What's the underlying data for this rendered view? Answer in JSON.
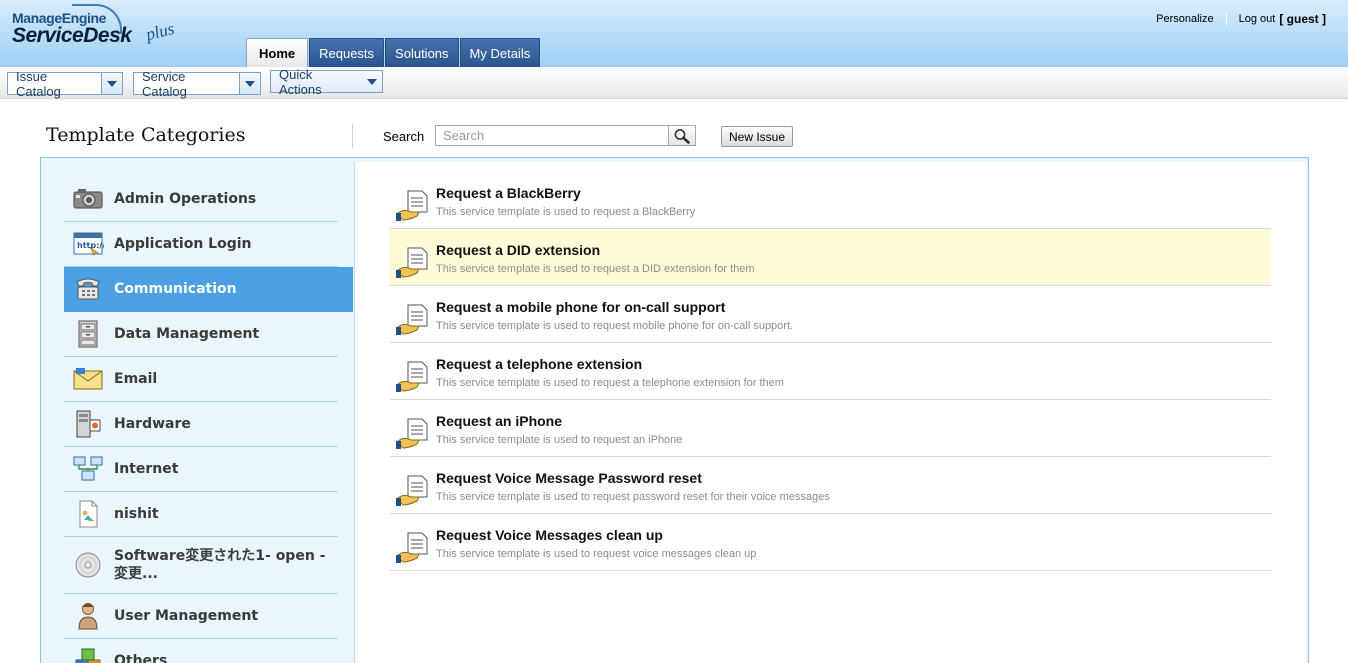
{
  "header": {
    "logo_top": "ManageEngine",
    "logo_main": "ServiceDesk",
    "logo_plus": "plus",
    "personalize": "Personalize",
    "logout": "Log out",
    "user": "[ guest ]",
    "tabs": [
      {
        "label": "Home",
        "active": true
      },
      {
        "label": "Requests",
        "active": false
      },
      {
        "label": "Solutions",
        "active": false
      },
      {
        "label": "My Details",
        "active": false
      }
    ]
  },
  "subbar": {
    "issue_catalog": "Issue Catalog",
    "service_catalog": "Service Catalog",
    "quick_actions": "Quick Actions"
  },
  "page": {
    "title": "Template Categories",
    "search_label": "Search",
    "search_placeholder": "Search",
    "new_issue": "New Issue"
  },
  "categories": [
    {
      "label": "Admin Operations",
      "icon": "camera-icon"
    },
    {
      "label": "Application Login",
      "icon": "browser-login-icon"
    },
    {
      "label": "Communication",
      "icon": "telephone-icon",
      "active": true
    },
    {
      "label": "Data Management",
      "icon": "filing-cabinet-icon"
    },
    {
      "label": "Email",
      "icon": "envelope-icon"
    },
    {
      "label": "Hardware",
      "icon": "computer-tower-icon"
    },
    {
      "label": "Internet",
      "icon": "network-icon"
    },
    {
      "label": "nishit",
      "icon": "document-icon"
    },
    {
      "label": "Software変更された1- open - 変更...",
      "icon": "cd-disc-icon"
    },
    {
      "label": "User Management",
      "icon": "user-icon"
    },
    {
      "label": "Others",
      "icon": "boxes-icon"
    }
  ],
  "templates": [
    {
      "title": "Request a BlackBerry",
      "desc": "This service template is used to request a BlackBerry"
    },
    {
      "title": "Request a DID extension",
      "desc": "This service template is used to request a DID extension for them",
      "highlight": true
    },
    {
      "title": "Request a mobile phone for on-call support",
      "desc": "This service template is used to request mobile phone for on-call support."
    },
    {
      "title": "Request a telephone extension",
      "desc": "This service template is used to request a telephone extension for them"
    },
    {
      "title": "Request an iPhone",
      "desc": "This service template is used to request an iPhone"
    },
    {
      "title": "Request Voice Message Password reset",
      "desc": "This service template is used to request password reset for their voice messages"
    },
    {
      "title": "Request Voice Messages clean up",
      "desc": "This service template is used to request voice messages clean up"
    }
  ],
  "colors": {
    "active_category": "#4aa0e2",
    "highlight_row": "#fefcd8",
    "tab_blue": "#2b548e"
  }
}
